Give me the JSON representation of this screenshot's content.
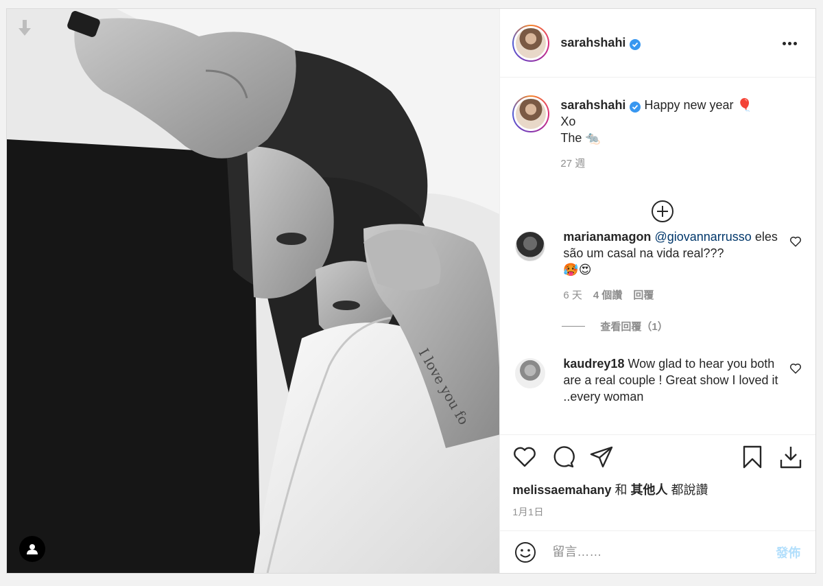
{
  "header": {
    "username": "sarahshahi"
  },
  "caption": {
    "username": "sarahshahi",
    "line1": "Happy new year 🎈",
    "line2": "Xo",
    "line3": "The 🐀",
    "time": "27 週"
  },
  "comments": [
    {
      "username": "marianamagon",
      "mention": "@giovannarrusso",
      "text": "eles são um casal na vida real???",
      "emoji": "🥵😍",
      "time": "6 天",
      "likes": "4 個讚",
      "reply": "回覆",
      "view_replies": "查看回覆（1）"
    },
    {
      "username": "kaudrey18",
      "text": "Wow glad to hear you both are a real couple ! Great show I loved it ..every woman"
    }
  ],
  "likes": {
    "user": "melissaemahany",
    "conj": "和",
    "others": "其他人",
    "suffix": "都說讚"
  },
  "date": "1月1日",
  "add_comment": {
    "placeholder": "留言……",
    "post_label": "發佈"
  },
  "icons": {
    "download": "download-arrow-icon",
    "tag": "user-tag-icon",
    "verified": "verified-badge-icon",
    "more": "more-options-icon",
    "load_more": "plus-circle-icon",
    "like": "heart-icon",
    "comment": "comment-icon",
    "share": "paper-plane-icon",
    "save": "bookmark-icon",
    "save_download": "download-icon",
    "emoji": "emoji-icon"
  },
  "colors": {
    "verified": "#3897f0",
    "link": "#00376b",
    "post_disabled": "#b2dffc",
    "muted": "#8e8e8e"
  }
}
